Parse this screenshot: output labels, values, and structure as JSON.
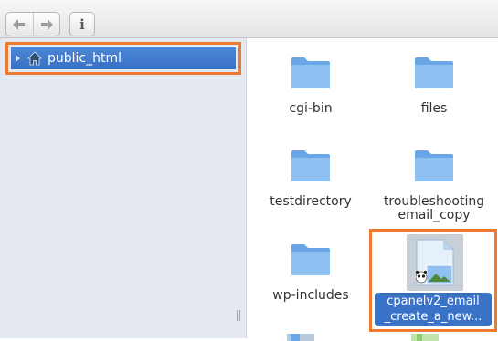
{
  "toolbar": {
    "back_icon": "arrow-left-icon",
    "forward_icon": "arrow-right-icon",
    "info_label": "i"
  },
  "tree": {
    "items": [
      {
        "label": "public_html",
        "icon": "home-icon",
        "expanded": false,
        "selected": true
      }
    ]
  },
  "files": {
    "items": [
      {
        "label": "cgi-bin",
        "type": "folder"
      },
      {
        "label": "files",
        "type": "folder"
      },
      {
        "label": "testdirectory",
        "type": "folder"
      },
      {
        "label": "troubleshooting email_copy",
        "type": "folder"
      },
      {
        "label": "wp-includes",
        "type": "folder"
      },
      {
        "label_line1": "cpanelv2_email",
        "label_line2": "_create_a_new...",
        "type": "image-file",
        "selected": true
      }
    ]
  },
  "colors": {
    "highlight_orange": "#ee7a32",
    "selection_blue": "#3a72c8",
    "folder_blue": "#6aa6e6",
    "sidebar_bg": "#e4e9f0"
  }
}
